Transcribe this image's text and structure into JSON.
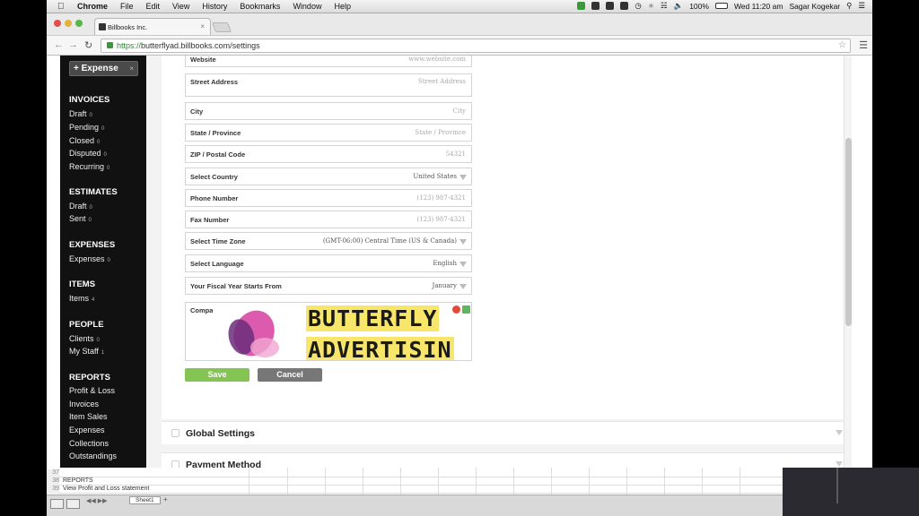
{
  "menubar": {
    "app": "Chrome",
    "items": [
      "File",
      "Edit",
      "View",
      "History",
      "Bookmarks",
      "Window",
      "Help"
    ],
    "battery": "100%",
    "datetime": "Wed 11:20 am",
    "user": "Sagar Kogekar"
  },
  "browser": {
    "tab_title": "Billbooks Inc.",
    "url_scheme": "https://",
    "url_rest": "butterflyad.billbooks.com/settings"
  },
  "sidebar": {
    "expense_button": "+ Expense",
    "expense_close": "×",
    "sections": [
      {
        "title": "INVOICES",
        "items": [
          {
            "label": "Draft",
            "count": "0"
          },
          {
            "label": "Pending",
            "count": "0"
          },
          {
            "label": "Closed",
            "count": "0"
          },
          {
            "label": "Disputed",
            "count": "0"
          },
          {
            "label": "Recurring",
            "count": "0"
          }
        ]
      },
      {
        "title": "ESTIMATES",
        "items": [
          {
            "label": "Draft",
            "count": "0"
          },
          {
            "label": "Sent",
            "count": "0"
          }
        ]
      },
      {
        "title": "EXPENSES",
        "items": [
          {
            "label": "Expenses",
            "count": "0"
          }
        ]
      },
      {
        "title": "ITEMS",
        "items": [
          {
            "label": "Items",
            "count": "4"
          }
        ]
      },
      {
        "title": "PEOPLE",
        "items": [
          {
            "label": "Clients",
            "count": "0"
          },
          {
            "label": "My Staff",
            "count": "1"
          }
        ]
      },
      {
        "title": "REPORTS",
        "items": [
          {
            "label": "Profit & Loss",
            "count": ""
          },
          {
            "label": "Invoices",
            "count": ""
          },
          {
            "label": "Item Sales",
            "count": ""
          },
          {
            "label": "Expenses",
            "count": ""
          },
          {
            "label": "Collections",
            "count": ""
          },
          {
            "label": "Outstandings",
            "count": ""
          }
        ]
      }
    ]
  },
  "form": {
    "fields": [
      {
        "label": "Website",
        "value": "www.website.com",
        "select": false,
        "dark": false
      },
      {
        "label": "Street Address",
        "value": "Street Address",
        "select": false,
        "dark": false
      },
      {
        "label": "City",
        "value": "City",
        "select": false,
        "dark": false
      },
      {
        "label": "State / Province",
        "value": "State / Province",
        "select": false,
        "dark": false
      },
      {
        "label": "ZIP / Postal Code",
        "value": "54321",
        "select": false,
        "dark": false
      },
      {
        "label": "Select Country",
        "value": "United States",
        "select": true,
        "dark": false
      },
      {
        "label": "Phone Number",
        "value": "(123) 987-4321",
        "select": false,
        "dark": false
      },
      {
        "label": "Fax Number",
        "value": "(123) 987-4321",
        "select": false,
        "dark": false
      },
      {
        "label": "Select Time Zone",
        "value": "(GMT-06:00) Central Time (US & Canada)",
        "select": true,
        "dark": true
      },
      {
        "label": "Select Language",
        "value": "English",
        "select": true,
        "dark": true
      },
      {
        "label": "Your Fiscal Year Starts From",
        "value": "January",
        "select": true,
        "dark": true
      }
    ],
    "logo_label": "Compan",
    "logo_line1": "BUTTERFLY",
    "logo_line2": "ADVERTISIN",
    "save": "Save",
    "cancel": "Cancel"
  },
  "accordions": [
    "Global Settings",
    "Payment Method"
  ],
  "sheet": {
    "rows": [
      {
        "n": "37",
        "text": ""
      },
      {
        "n": "38",
        "text": "REPORTS"
      },
      {
        "n": "39",
        "text": "View Profit and Loss statement"
      }
    ],
    "tab": "Sheet1",
    "add": "+"
  }
}
